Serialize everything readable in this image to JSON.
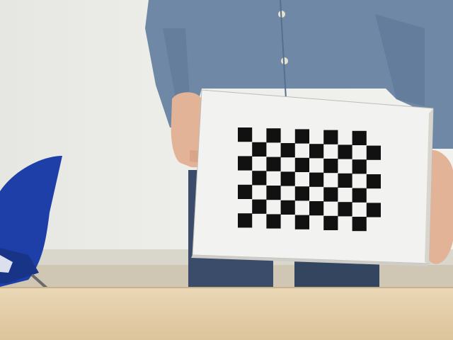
{
  "scene": {
    "description_free": true,
    "colors": {
      "wall": "#ececE8",
      "shirt": "#6e88a6",
      "jeans": "#3b4c6a",
      "chair": "#1f3fa8",
      "desk": "#dfc8a1",
      "board": "#f2f2f0",
      "square": "#111111",
      "skin": "#e2b397"
    },
    "checkerboard": {
      "rows": 7,
      "cols": 10
    }
  }
}
